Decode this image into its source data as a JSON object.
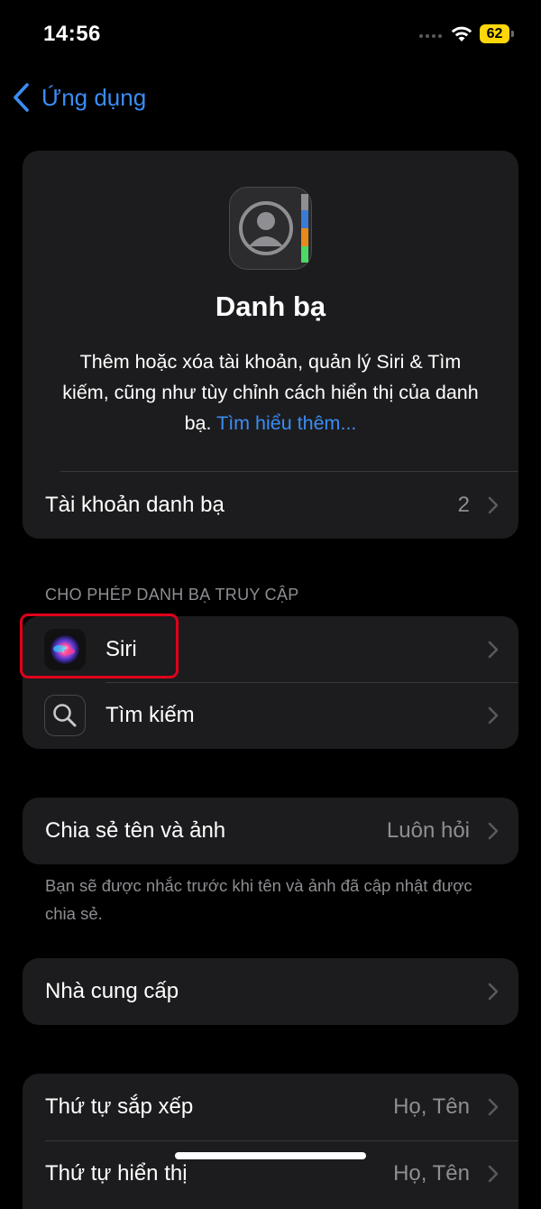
{
  "status": {
    "time": "14:56",
    "battery": "62"
  },
  "nav": {
    "back_label": "Ứng dụng"
  },
  "header": {
    "title": "Danh bạ",
    "description": "Thêm hoặc xóa tài khoản, quản lý Siri & Tìm kiếm, cũng như tùy chỉnh cách hiển thị của danh bạ. ",
    "learn_more": "Tìm hiểu thêm..."
  },
  "accounts_row": {
    "label": "Tài khoản danh bạ",
    "value": "2"
  },
  "access_section": {
    "header": "CHO PHÉP DANH BẠ TRUY CẬP",
    "items": [
      {
        "label": "Siri",
        "icon": "siri-icon"
      },
      {
        "label": "Tìm kiếm",
        "icon": "search-icon"
      }
    ]
  },
  "share_row": {
    "label": "Chia sẻ tên và ảnh",
    "value": "Luôn hỏi",
    "note": "Bạn sẽ được nhắc trước khi tên và ảnh đã cập nhật được chia sẻ."
  },
  "provider_row": {
    "label": "Nhà cung cấp"
  },
  "order_section": {
    "items": [
      {
        "label": "Thứ tự sắp xếp",
        "value": "Họ, Tên"
      },
      {
        "label": "Thứ tự hiển thị",
        "value": "Họ, Tên"
      }
    ]
  },
  "colors": {
    "accent": "#3a8df5",
    "card": "#1c1c1e",
    "highlight": "#e0001b"
  }
}
